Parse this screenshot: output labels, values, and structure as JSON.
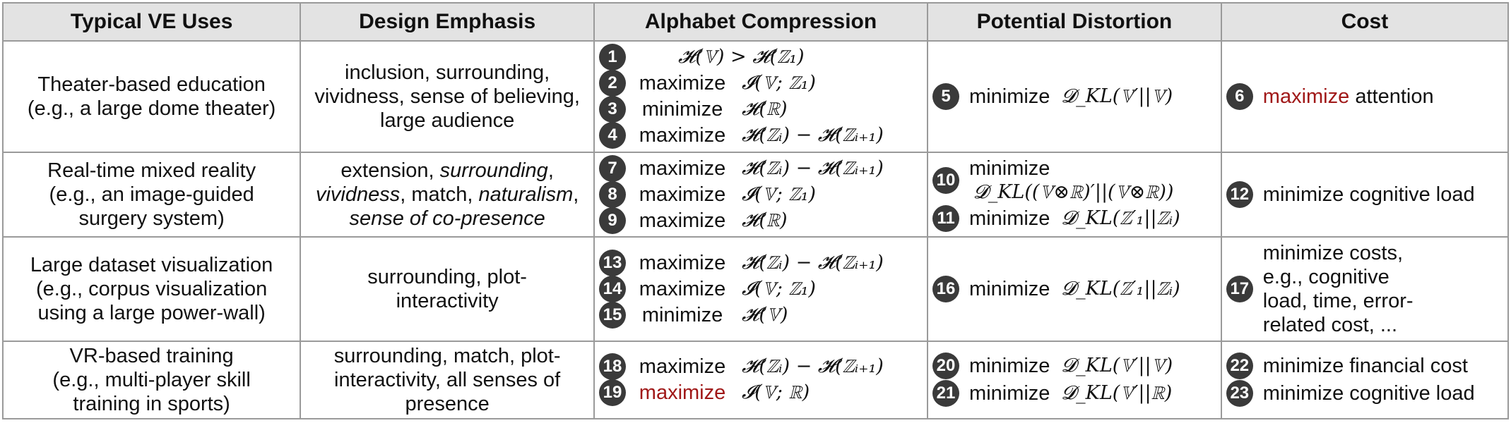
{
  "headers": [
    "Typical VE Uses",
    "Design Emphasis",
    "Alphabet Compression",
    "Potential Distortion",
    "Cost"
  ],
  "colors": {
    "header_bg": "#e3e3e3",
    "border": "#9a9a9a",
    "badge": "#3a3a3a",
    "highlight": "#a01818"
  },
  "rows": [
    {
      "uses": [
        "Theater-based education",
        "(e.g., a large dome theater)"
      ],
      "emphasis": [
        "inclusion, surrounding,",
        "vividness, sense of believing,",
        "large audience"
      ],
      "alphabet": [
        {
          "n": "1",
          "verb": "",
          "expr": "𝓗(𝕍) > 𝓗(ℤ₁)"
        },
        {
          "n": "2",
          "verb": "maximize",
          "expr": "𝓘(𝕍; ℤ₁)"
        },
        {
          "n": "3",
          "verb": "minimize",
          "expr": "𝓗(ℝ)"
        },
        {
          "n": "4",
          "verb": "maximize",
          "expr": "𝓗(ℤᵢ) − 𝓗(ℤᵢ₊₁)"
        }
      ],
      "distortion": [
        {
          "n": "5",
          "verb": "minimize",
          "expr": "𝓓_KL(𝕍′||𝕍)"
        }
      ],
      "cost": [
        {
          "n": "6",
          "highlight": "maximize",
          "text": " attention"
        }
      ]
    },
    {
      "uses": [
        "Real-time mixed reality",
        "(e.g., an image-guided",
        "surgery system)"
      ],
      "emphasis_html": "extension, <i>surrounding</i>,<br><i>vividness</i>, match, <i>naturalism</i>,<br><i>sense of co-presence</i>",
      "alphabet": [
        {
          "n": "7",
          "verb": "maximize",
          "expr": "𝓗(ℤᵢ) − 𝓗(ℤᵢ₊₁)"
        },
        {
          "n": "8",
          "verb": "maximize",
          "expr": "𝓘(𝕍; ℤ₁)"
        },
        {
          "n": "9",
          "verb": "maximize",
          "expr": "𝓗(ℝ)"
        }
      ],
      "distortion": [
        {
          "n": "10",
          "verb": "minimize",
          "expr": "𝓓_KL((𝕍⊗ℝ)′||(𝕍⊗ℝ))"
        },
        {
          "n": "11",
          "verb": "minimize",
          "expr": "𝓓_KL(ℤ′₁||ℤᵢ)"
        }
      ],
      "cost": [
        {
          "n": "12",
          "highlight": "",
          "text": "minimize cognitive load"
        }
      ]
    },
    {
      "uses": [
        "Large dataset visualization",
        "(e.g., corpus visualization",
        "using a large power-wall)"
      ],
      "emphasis": [
        "surrounding, plot-",
        "interactivity"
      ],
      "alphabet": [
        {
          "n": "13",
          "verb": "maximize",
          "expr": "𝓗(ℤᵢ) − 𝓗(ℤᵢ₊₁)"
        },
        {
          "n": "14",
          "verb": "maximize",
          "expr": "𝓘(𝕍; ℤ₁)"
        },
        {
          "n": "15",
          "verb": "minimize",
          "expr": "𝓗(𝕍)"
        }
      ],
      "distortion": [
        {
          "n": "16",
          "verb": "minimize",
          "expr": "𝓓_KL(ℤ′₁||ℤᵢ)"
        }
      ],
      "cost": [
        {
          "n": "17",
          "highlight": "",
          "text": "minimize costs, e.g., cognitive load, time, error-related cost, ..."
        }
      ]
    },
    {
      "uses": [
        "VR-based training",
        "(e.g., multi-player skill",
        "training in sports)"
      ],
      "emphasis": [
        "surrounding, match, plot-",
        "interactivity, all senses of",
        "presence"
      ],
      "alphabet": [
        {
          "n": "18",
          "verb": "maximize",
          "expr": "𝓗(ℤᵢ) − 𝓗(ℤᵢ₊₁)"
        },
        {
          "n": "19",
          "verb": "maximize",
          "verb_highlight": true,
          "expr": "𝓘(𝕍; ℝ)"
        }
      ],
      "distortion": [
        {
          "n": "20",
          "verb": "minimize",
          "expr": "𝓓_KL(𝕍′||𝕍)"
        },
        {
          "n": "21",
          "verb": "minimize",
          "expr": "𝓓_KL(𝕍′||ℝ)"
        }
      ],
      "cost": [
        {
          "n": "22",
          "highlight": "",
          "text": "minimize financial cost"
        },
        {
          "n": "23",
          "highlight": "",
          "text": "minimize cognitive load"
        }
      ]
    }
  ]
}
